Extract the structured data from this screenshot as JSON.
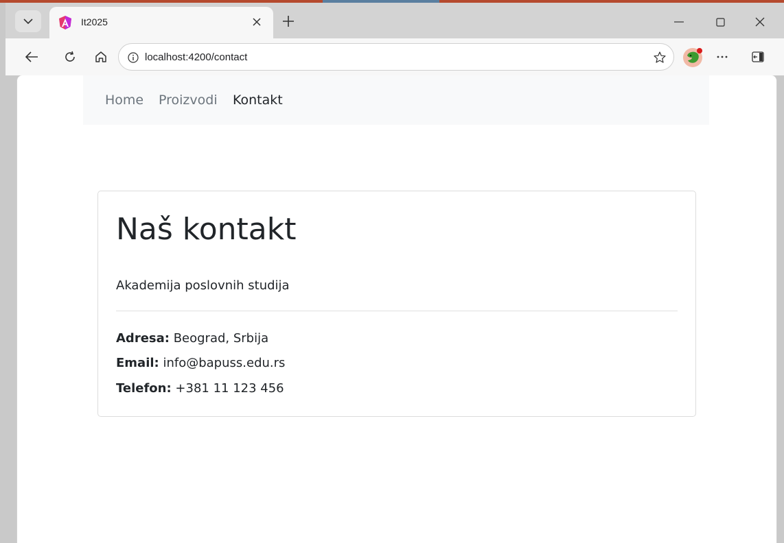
{
  "browser": {
    "tab_title": "It2025",
    "url": "localhost:4200/contact"
  },
  "nav": {
    "home": "Home",
    "products": "Proizvodi",
    "contact": "Kontakt"
  },
  "card": {
    "title": "Naš kontakt",
    "subtitle": "Akademija poslovnih studija",
    "address_label": "Adresa:",
    "address_value": " Beograd, Srbija",
    "email_label": "Email:",
    "email_value": " info@bapuss.edu.rs",
    "phone_label": "Telefon:",
    "phone_value": " +381 11 123 456"
  }
}
